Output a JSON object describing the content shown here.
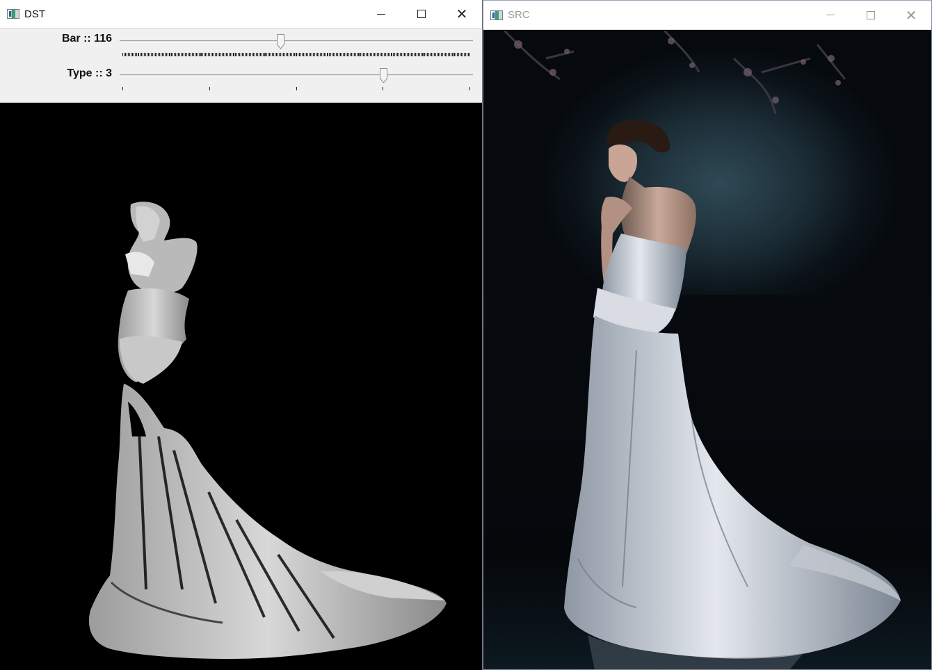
{
  "dst_window": {
    "title": "DST",
    "trackbars": [
      {
        "label": "Bar :: 116",
        "value": 116,
        "max": 255
      },
      {
        "label": "Type :: 3",
        "value": 3,
        "max": 4
      }
    ]
  },
  "src_window": {
    "title": "SRC"
  },
  "colors": {
    "titlebar_bg": "#ffffff",
    "trackpanel_bg": "#f0f0f0",
    "image_bg": "#000000"
  },
  "icons": [
    "opencv-window-icon",
    "minimize-icon",
    "maximize-icon",
    "close-icon",
    "slider-thumb-icon"
  ]
}
